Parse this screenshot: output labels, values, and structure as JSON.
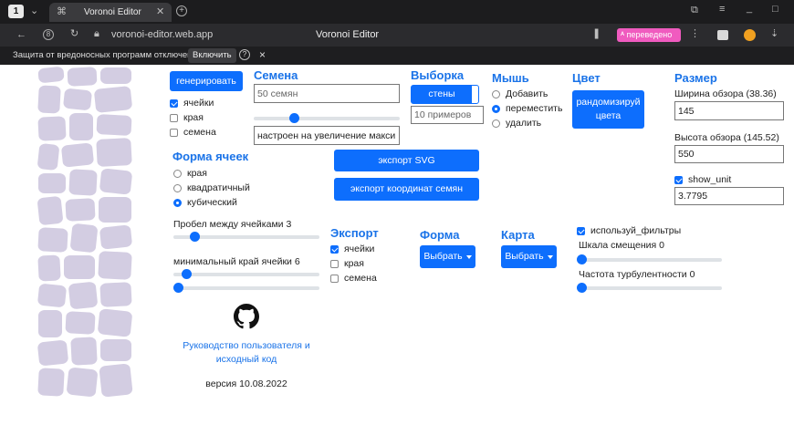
{
  "browser": {
    "tab_count": "1",
    "tab_title": "Voronoi Editor",
    "url": "voronoi-editor.web.app",
    "page_title": "Voronoi Editor",
    "translated_badge": "переведено",
    "warning_text": "Защита от вредоносных программ отключена",
    "enable_label": "Включить",
    "help_label": "?",
    "close_label": "×"
  },
  "generate_label": "генерировать",
  "show": {
    "items": [
      {
        "label": "ячейки",
        "checked": true
      },
      {
        "label": "края",
        "checked": false
      },
      {
        "label": "семена",
        "checked": false
      }
    ]
  },
  "seeds": {
    "heading": "Семена",
    "count_placeholder": "50 семян",
    "mode_value": "настроен на увеличение макси"
  },
  "sampling": {
    "heading": "Выборка",
    "walls_label": "стены",
    "samples_placeholder": "10 примеров"
  },
  "mouse": {
    "heading": "Мышь",
    "options": [
      {
        "label": "Добавить",
        "selected": false
      },
      {
        "label": "переместить",
        "selected": true
      },
      {
        "label": "удалить",
        "selected": false
      }
    ]
  },
  "color": {
    "heading": "Цвет",
    "randomize_label": "рандомизируй цвета"
  },
  "size": {
    "heading": "Размер",
    "width_label": "Ширина обзора (38.36)",
    "width_value": "145",
    "height_label": "Высота обзора (145.52)",
    "height_value": "550",
    "show_unit_label": "show_unit",
    "show_unit_checked": true,
    "unit_value": "3.7795"
  },
  "cell_shape": {
    "heading": "Форма ячеек",
    "options": [
      {
        "label": "края",
        "selected": false
      },
      {
        "label": "квадратичный",
        "selected": false
      },
      {
        "label": "кубический",
        "selected": true
      }
    ]
  },
  "export_svg_label": "экспорт SVG",
  "export_seeds_label": "экспорт координат семян",
  "gap": {
    "label": "Пробел между ячейками 3",
    "fraction": 0.12
  },
  "min_edge": {
    "label": "минимальный край ячейки 6",
    "fraction": 0.06
  },
  "extra_slider_fraction": 0.0,
  "seeds_slider_fraction": 0.26,
  "export": {
    "heading": "Экспорт",
    "items": [
      {
        "label": "ячейки",
        "checked": true
      },
      {
        "label": "края",
        "checked": false
      },
      {
        "label": "семена",
        "checked": false
      }
    ]
  },
  "shape": {
    "heading": "Форма",
    "select_label": "Выбрать"
  },
  "map": {
    "heading": "Карта",
    "select_label": "Выбрать"
  },
  "filters": {
    "use_label": "используй_фильтры",
    "use_checked": true,
    "offset_label": "Шкала смещения 0",
    "offset_fraction": 0.0,
    "turbulence_label": "Частота турбулентности 0",
    "turbulence_fraction": 0.0
  },
  "footer": {
    "guide_link": "Руководство пользователя и исходный код",
    "version": "версия 10.08.2022"
  },
  "colors": {
    "accent": "#0d6efd",
    "cell": "#d3cde2",
    "heading": "#1a73e8"
  }
}
